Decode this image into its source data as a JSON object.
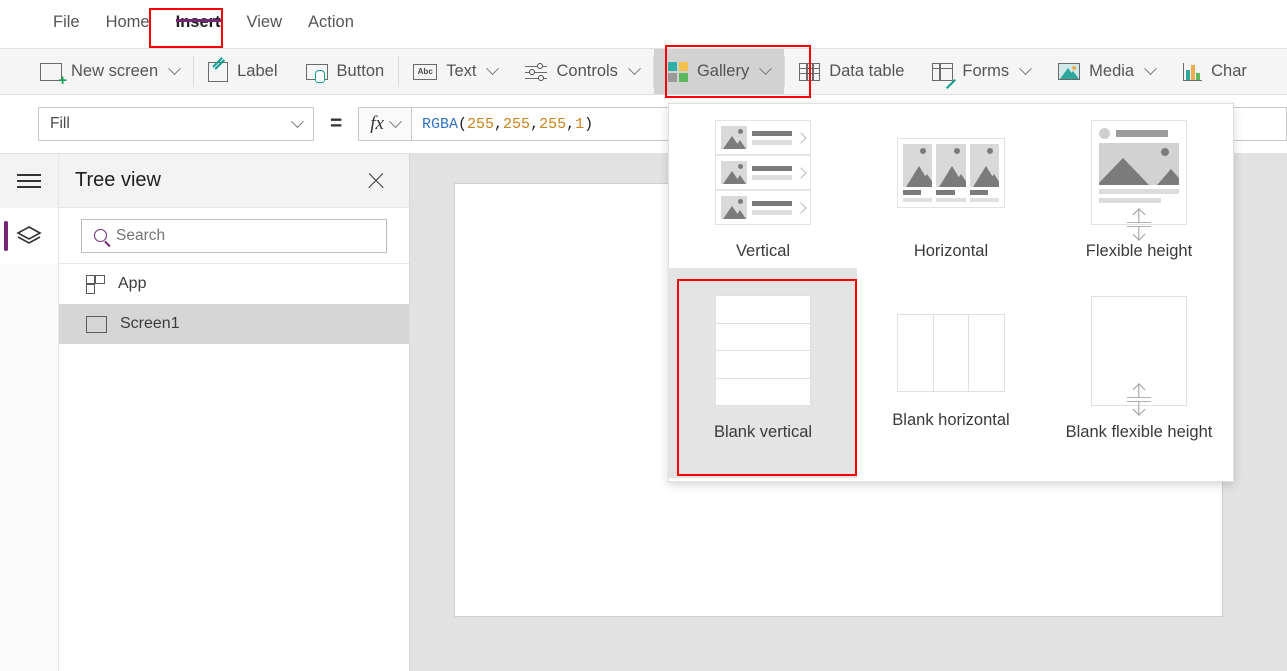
{
  "menubar": {
    "items": [
      {
        "label": "File",
        "active": false
      },
      {
        "label": "Home",
        "active": false
      },
      {
        "label": "Insert",
        "active": true
      },
      {
        "label": "View",
        "active": false
      },
      {
        "label": "Action",
        "active": false
      }
    ],
    "active_accent": "#742774",
    "highlight_color": "#ff0000"
  },
  "ribbon": {
    "items": [
      {
        "label": "New screen",
        "icon": "new-screen-icon",
        "has_caret": true
      },
      {
        "label": "Label",
        "icon": "label-icon",
        "has_caret": false
      },
      {
        "label": "Button",
        "icon": "button-icon",
        "has_caret": false
      },
      {
        "label": "Text",
        "icon": "text-icon",
        "has_caret": true
      },
      {
        "label": "Controls",
        "icon": "controls-icon",
        "has_caret": true
      },
      {
        "label": "Gallery",
        "icon": "gallery-icon",
        "has_caret": true,
        "selected": true
      },
      {
        "label": "Data table",
        "icon": "data-table-icon",
        "has_caret": false
      },
      {
        "label": "Forms",
        "icon": "forms-icon",
        "has_caret": true
      },
      {
        "label": "Media",
        "icon": "media-icon",
        "has_caret": true
      },
      {
        "label": "Char",
        "icon": "charts-icon",
        "has_caret": false
      }
    ],
    "gallery_icon_colors": [
      "#2fb0a8",
      "#f2c14e",
      "#9a9a9a",
      "#5eb85e"
    ],
    "accent_teal": "#0f9b92"
  },
  "formula_bar": {
    "property": "Fill",
    "equals": "=",
    "fx_label": "fx",
    "formula_parts": [
      {
        "text": "RGBA",
        "kind": "fn"
      },
      {
        "text": "(",
        "kind": "paren"
      },
      {
        "text": "255",
        "kind": "num"
      },
      {
        "text": ", ",
        "kind": "paren"
      },
      {
        "text": "255",
        "kind": "num"
      },
      {
        "text": ", ",
        "kind": "paren"
      },
      {
        "text": "255",
        "kind": "num"
      },
      {
        "text": ", ",
        "kind": "paren"
      },
      {
        "text": "1",
        "kind": "num"
      },
      {
        "text": ")",
        "kind": "paren"
      }
    ],
    "formula_text": "RGBA(255, 255, 255, 1)"
  },
  "left_rail": {
    "menu_icon": "hamburger-icon",
    "tree_view_icon": "layers-icon",
    "active_accent": "#742774"
  },
  "tree_view": {
    "title": "Tree view",
    "close_icon": "close-icon",
    "search": {
      "placeholder": "Search",
      "value": "",
      "icon": "search-icon"
    },
    "items": [
      {
        "label": "App",
        "icon": "app-icon",
        "selected": false
      },
      {
        "label": "Screen1",
        "icon": "screen-icon",
        "selected": true
      }
    ]
  },
  "gallery_dropdown": {
    "options": [
      {
        "label": "Vertical",
        "thumb": "vertical-gallery-thumb",
        "selected": false
      },
      {
        "label": "Horizontal",
        "thumb": "horizontal-gallery-thumb",
        "selected": false
      },
      {
        "label": "Flexible height",
        "thumb": "flexible-height-gallery-thumb",
        "selected": false
      },
      {
        "label": "Blank vertical",
        "thumb": "blank-vertical-gallery-thumb",
        "selected": true
      },
      {
        "label": "Blank horizontal",
        "thumb": "blank-horizontal-gallery-thumb",
        "selected": false
      },
      {
        "label": "Blank flexible height",
        "thumb": "blank-flexible-height-gallery-thumb",
        "selected": false
      }
    ]
  },
  "canvas": {
    "screen_name": "Screen1",
    "background": "#e2e2e2",
    "screen_fill": "#ffffff"
  }
}
